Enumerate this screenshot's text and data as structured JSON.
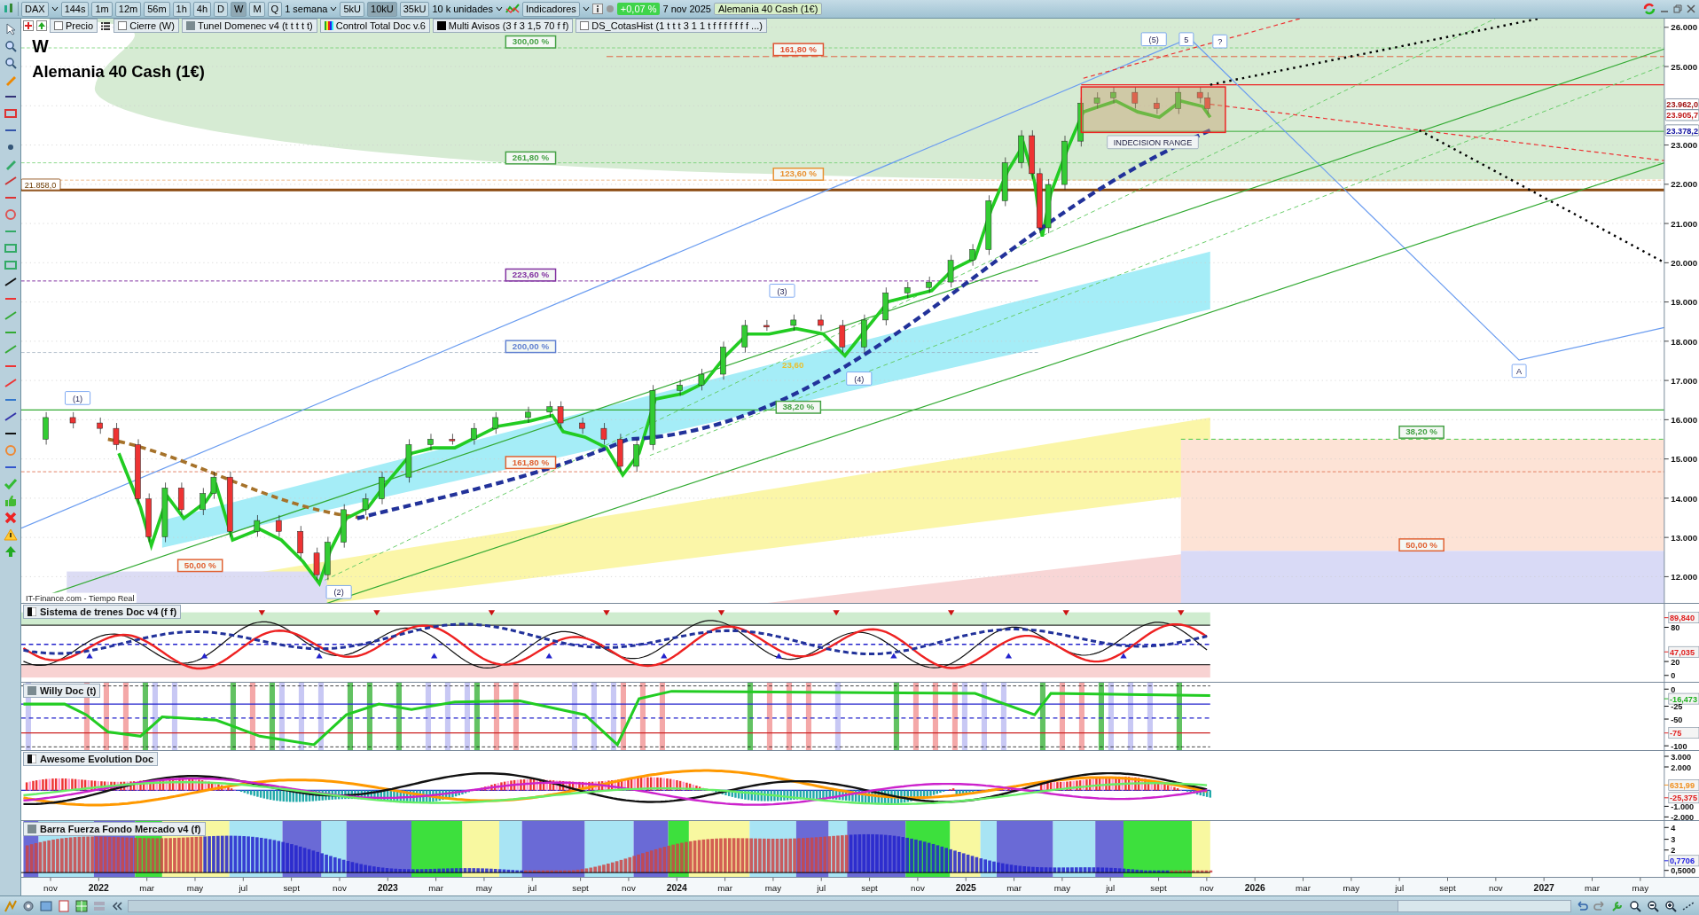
{
  "toolbar": {
    "symbol": "DAX",
    "timeframes": [
      {
        "label": "144s",
        "selected": false
      },
      {
        "label": "1m",
        "selected": false
      },
      {
        "label": "12m",
        "selected": false
      },
      {
        "label": "56m",
        "selected": false
      },
      {
        "label": "1h",
        "selected": false
      },
      {
        "label": "4h",
        "selected": false
      },
      {
        "label": "D",
        "selected": false
      },
      {
        "label": "W",
        "selected": true
      },
      {
        "label": "M",
        "selected": false
      },
      {
        "label": "Q",
        "selected": false
      }
    ],
    "period": "1 semana",
    "unit_buttons": [
      {
        "label": "5kU",
        "selected": false
      },
      {
        "label": "10kU",
        "selected": true
      },
      {
        "label": "35kU",
        "selected": false
      }
    ],
    "units": "10 k unidades",
    "indicators": "Indicadores",
    "change": "+0,07 %",
    "date": "7 nov 2025",
    "instrument": "Alemania 40 Cash (1€)"
  },
  "legend": [
    {
      "kind": "checkbox",
      "label": "Precio",
      "checked": false
    },
    {
      "kind": "checkbox",
      "label": "Cierre (W)",
      "checked": false
    },
    {
      "kind": "swatch-grey",
      "label": "Tunel Domenec v4 (t t t t t)"
    },
    {
      "kind": "swatch-bars",
      "label": "Control Total Doc v.6"
    },
    {
      "kind": "swatch-black",
      "label": "Multi Avisos (3 f 3 1,5 70 f f)"
    },
    {
      "kind": "checkbox",
      "label": "DS_CotasHist (1 t t t 3 1 1 t f f f f f f f ...)",
      "checked": false
    }
  ],
  "chart": {
    "period_letter": "W",
    "title": "Alemania 40 Cash (1€)",
    "source": "IT-Finance.com - Tiempo Real",
    "level_tag": "21.858,0",
    "range_label": "INDECISION RANGE",
    "fib_labels": [
      {
        "text": "300,00 %",
        "color": "#44a044"
      },
      {
        "text": "161,80 %",
        "color": "#e05030"
      },
      {
        "text": "261,80 %",
        "color": "#44a044"
      },
      {
        "text": "123,60 %",
        "color": "#e89030"
      },
      {
        "text": "223,60 %",
        "color": "#8030a0"
      },
      {
        "text": "200,00 %",
        "color": "#6080d0"
      },
      {
        "text": "23,60",
        "color": "#e8c030"
      },
      {
        "text": "38,20 %",
        "color": "#44a044"
      },
      {
        "text": "161,80 %",
        "color": "#e06030"
      },
      {
        "text": "50,00 %",
        "color": "#e06030"
      },
      {
        "text": "38,20 %",
        "color": "#44a044"
      },
      {
        "text": "50,00 %",
        "color": "#e06030"
      }
    ],
    "wave_labels": [
      "(1)",
      "(2)",
      "(3)",
      "(4)",
      "(5)",
      "5",
      "?",
      "A"
    ],
    "price_axis": [
      "26.000",
      "25.000",
      "23.000",
      "22.000",
      "21.000",
      "20.000",
      "19.000",
      "18.000",
      "17.000",
      "16.000",
      "15.000",
      "14.000",
      "13.000",
      "12.000"
    ],
    "price_tags": [
      {
        "text": "23.962,0",
        "color": "#a01010"
      },
      {
        "text": "23.905,7",
        "color": "#c01818"
      },
      {
        "text": "23.378,2",
        "color": "#1010a0"
      }
    ]
  },
  "panels": [
    {
      "kind": "trenes",
      "title": "Sistema de trenes Doc v4 (f f)",
      "axis": [
        {
          "text": "89,840",
          "kind": "tag",
          "color": "#e02020"
        },
        {
          "text": "80",
          "kind": "tick"
        },
        {
          "text": "47,035",
          "kind": "tag",
          "color": "#e02020"
        },
        {
          "text": "20",
          "kind": "tick"
        },
        {
          "text": "0",
          "kind": "tick"
        }
      ]
    },
    {
      "kind": "willy",
      "title": "Willy Doc (t)",
      "axis": [
        {
          "text": "0",
          "kind": "tick"
        },
        {
          "text": "-16,473",
          "kind": "tag",
          "color": "#20b020"
        },
        {
          "text": "-25",
          "kind": "tick"
        },
        {
          "text": "-50",
          "kind": "tick"
        },
        {
          "text": "-75",
          "kind": "tag",
          "color": "#e02020"
        },
        {
          "text": "-100",
          "kind": "tick"
        }
      ]
    },
    {
      "kind": "awesome",
      "title": "Awesome Evolution Doc",
      "axis": [
        {
          "text": "3.000",
          "kind": "tick"
        },
        {
          "text": "2.000",
          "kind": "tick"
        },
        {
          "text": "631,99",
          "kind": "tag",
          "color": "#f09020"
        },
        {
          "text": "-25,375",
          "kind": "tag",
          "color": "#e02020"
        },
        {
          "text": "-1.000",
          "kind": "tick"
        },
        {
          "text": "-2.000",
          "kind": "tick"
        }
      ]
    },
    {
      "kind": "barra",
      "title": "Barra Fuerza Fondo Mercado v4 (f)",
      "axis": [
        {
          "text": "4",
          "kind": "tick"
        },
        {
          "text": "3",
          "kind": "tick"
        },
        {
          "text": "2",
          "kind": "tick"
        },
        {
          "text": "0,7706",
          "kind": "tag",
          "color": "#2020e0"
        },
        {
          "text": "0,5000",
          "kind": "tick"
        }
      ]
    }
  ],
  "time_axis": [
    {
      "text": "nov",
      "kind": "month"
    },
    {
      "text": "2022",
      "kind": "year"
    },
    {
      "text": "mar",
      "kind": "month"
    },
    {
      "text": "may",
      "kind": "month"
    },
    {
      "text": "jul",
      "kind": "month"
    },
    {
      "text": "sept",
      "kind": "month"
    },
    {
      "text": "nov",
      "kind": "month"
    },
    {
      "text": "2023",
      "kind": "year"
    },
    {
      "text": "mar",
      "kind": "month"
    },
    {
      "text": "may",
      "kind": "month"
    },
    {
      "text": "jul",
      "kind": "month"
    },
    {
      "text": "sept",
      "kind": "month"
    },
    {
      "text": "nov",
      "kind": "month"
    },
    {
      "text": "2024",
      "kind": "year"
    },
    {
      "text": "mar",
      "kind": "month"
    },
    {
      "text": "may",
      "kind": "month"
    },
    {
      "text": "jul",
      "kind": "month"
    },
    {
      "text": "sept",
      "kind": "month"
    },
    {
      "text": "nov",
      "kind": "month"
    },
    {
      "text": "2025",
      "kind": "year"
    },
    {
      "text": "mar",
      "kind": "month"
    },
    {
      "text": "may",
      "kind": "month"
    },
    {
      "text": "jul",
      "kind": "month"
    },
    {
      "text": "sept",
      "kind": "month"
    },
    {
      "text": "nov",
      "kind": "month"
    },
    {
      "text": "2026",
      "kind": "year"
    },
    {
      "text": "mar",
      "kind": "month"
    },
    {
      "text": "may",
      "kind": "month"
    },
    {
      "text": "jul",
      "kind": "month"
    },
    {
      "text": "sept",
      "kind": "month"
    },
    {
      "text": "nov",
      "kind": "month"
    },
    {
      "text": "2027",
      "kind": "year"
    },
    {
      "text": "mar",
      "kind": "month"
    },
    {
      "text": "may",
      "kind": "month"
    }
  ]
}
